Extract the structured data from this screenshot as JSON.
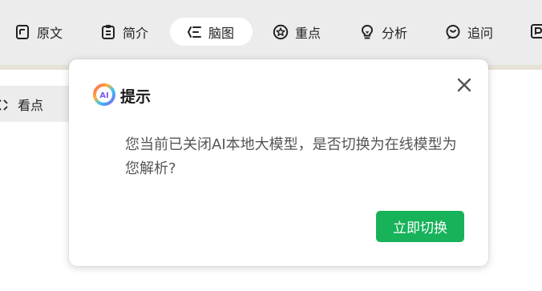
{
  "toolbar": {
    "tabs": [
      {
        "label": "原文",
        "icon": "document-icon",
        "active": false
      },
      {
        "label": "简介",
        "icon": "clipboard-icon",
        "active": false
      },
      {
        "label": "脑图",
        "icon": "mindmap-icon",
        "active": true
      },
      {
        "label": "重点",
        "icon": "star-circle-icon",
        "active": false
      },
      {
        "label": "分析",
        "icon": "lightbulb-icon",
        "active": false
      },
      {
        "label": "追问",
        "icon": "chat-question-icon",
        "active": false
      }
    ]
  },
  "sidebar": {
    "items": [
      {
        "label": "看点",
        "icon": "expand-icon"
      }
    ]
  },
  "dialog": {
    "logo_text": "AI",
    "title": "提示",
    "message": "您当前已关闭AI本地大模型，是否切换为在线模型为您解析?",
    "confirm_label": "立即切换"
  },
  "colors": {
    "toolbar_bg": "#ececec",
    "active_tab_bg": "#ffffff",
    "button_green": "#17b25a",
    "dialog_bg": "#ffffff"
  }
}
